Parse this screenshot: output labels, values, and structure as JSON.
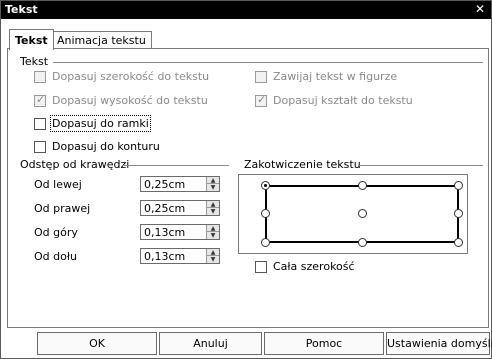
{
  "window": {
    "title": "Tekst"
  },
  "tabs": [
    {
      "label": "Tekst",
      "active": true
    },
    {
      "label": "Animacja tekstu",
      "active": false
    }
  ],
  "text_section": {
    "label": "Tekst",
    "options": [
      {
        "label": "Dopasuj szerokość do tekstu",
        "checked": false,
        "enabled": false
      },
      {
        "label": "Dopasuj wysokość do tekstu",
        "checked": true,
        "enabled": false
      },
      {
        "label": "Dopasuj do ramki",
        "checked": false,
        "enabled": true,
        "focused": true
      },
      {
        "label": "Dopasuj do konturu",
        "checked": false,
        "enabled": true
      },
      {
        "label": "Zawijaj tekst w figurze",
        "checked": false,
        "enabled": false
      },
      {
        "label": "Dopasuj kształt do tekstu",
        "checked": true,
        "enabled": false
      }
    ]
  },
  "spacing_section": {
    "label": "Odstęp od krawędzi",
    "fields": [
      {
        "label": "Od lewej",
        "value": "0,25cm"
      },
      {
        "label": "Od prawej",
        "value": "0,25cm"
      },
      {
        "label": "Od góry",
        "value": "0,13cm"
      },
      {
        "label": "Od dołu",
        "value": "0,13cm"
      }
    ]
  },
  "anchor_section": {
    "label": "Zakotwiczenie tekstu",
    "selected": "top-left",
    "full_width": {
      "label": "Cała szerokość",
      "checked": false
    }
  },
  "buttons": {
    "ok": "OK",
    "cancel": "Anuluj",
    "help": "Pomoc",
    "reset": "Ustawienia domyślne"
  },
  "icons": {
    "close": "close-icon",
    "spin_up": "spin-up-icon",
    "spin_down": "spin-down-icon"
  }
}
